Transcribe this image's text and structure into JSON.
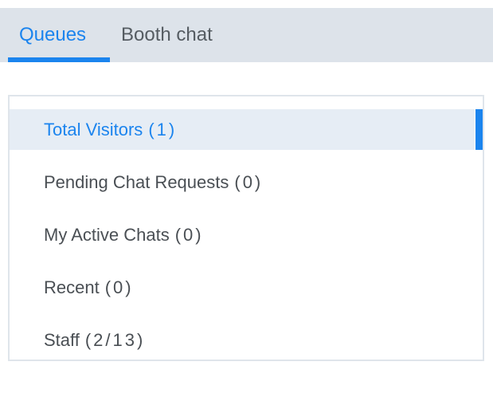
{
  "tabs": {
    "queues_label": "Queues",
    "booth_chat_label": "Booth chat",
    "active": "Queues"
  },
  "queues": {
    "items": [
      {
        "label": "Total Visitors",
        "count": "(1)",
        "active": true
      },
      {
        "label": "Pending Chat Requests",
        "count": "(0)",
        "active": false
      },
      {
        "label": "My Active Chats",
        "count": "(0)",
        "active": false
      },
      {
        "label": "Recent",
        "count": "(0)",
        "active": false
      },
      {
        "label": "Staff",
        "count": "(2/13)",
        "active": false
      }
    ]
  },
  "colors": {
    "accent": "#1b84ee",
    "tabbar_bg": "#dde3ea",
    "active_row_bg": "#e6edf5",
    "text": "#4a4f54"
  }
}
